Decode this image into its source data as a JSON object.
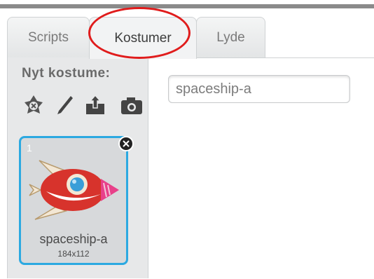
{
  "tabs": [
    {
      "label": "Scripts",
      "active": false
    },
    {
      "label": "Kostumer",
      "active": true
    },
    {
      "label": "Lyde",
      "active": false
    }
  ],
  "sidebar": {
    "new_costume_label": "Nyt kostume:",
    "tools": [
      "paint-costume-library-icon",
      "paint-brush-icon",
      "upload-icon",
      "camera-icon"
    ]
  },
  "costume": {
    "number": "1",
    "name": "spaceship-a",
    "size": "184x112"
  },
  "editor": {
    "name_value": "spaceship-a"
  },
  "colors": {
    "accent": "#2ca9e1",
    "highlight": "#e01c1c"
  }
}
